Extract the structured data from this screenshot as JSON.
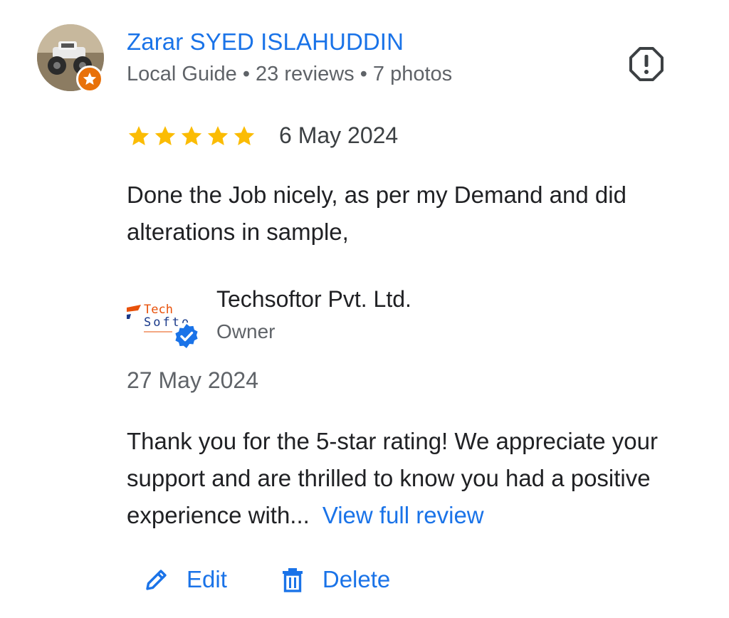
{
  "reviewer": {
    "name": "Zarar SYED ISLAHUDDIN",
    "meta": "Local Guide • 23 reviews • 7 photos",
    "avatar_icon": "avatar-photo",
    "badge_icon": "local-guide-star-icon"
  },
  "review": {
    "rating": 5,
    "max_rating": 5,
    "date": "6 May 2024",
    "text": "Done the Job nicely, as per my Demand and did alterations in sample,"
  },
  "owner_reply": {
    "name": "Techsoftor Pvt. Ltd.",
    "role": "Owner",
    "logo_text_line1": "Tech",
    "logo_text_line2": "Softo",
    "date": "27 May 2024",
    "text": "Thank you for the 5-star rating! We appreciate your support and are thrilled to know you had a positive experience with...",
    "view_full_label": "View full review"
  },
  "actions": {
    "edit_label": "Edit",
    "delete_label": "Delete"
  },
  "colors": {
    "link_blue": "#1a73e8",
    "star_yellow": "#fbbc04",
    "badge_orange": "#e8710a",
    "text_gray": "#5f6368"
  }
}
